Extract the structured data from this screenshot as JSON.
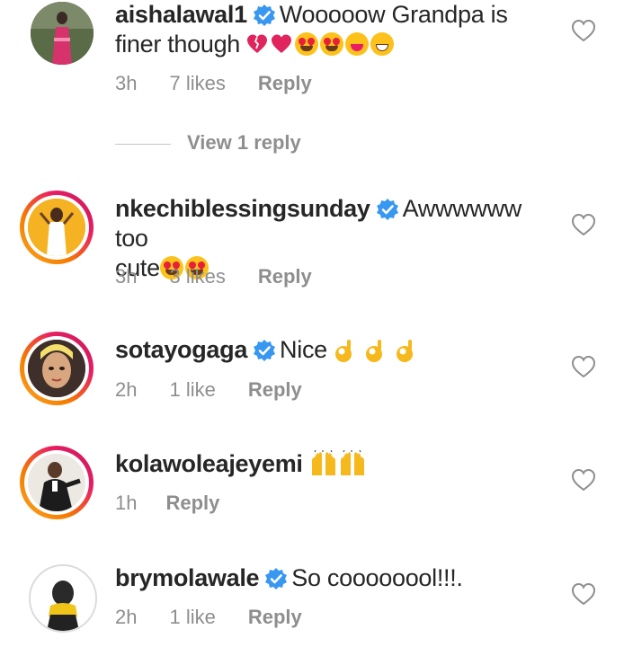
{
  "comments": [
    {
      "username": "aishalawal1",
      "verified": true,
      "text": "Wooooow Grandpa is finer though",
      "time": "3h",
      "likes": "7 likes",
      "reply_label": "Reply",
      "emoji": [
        "broken-heart",
        "red-heart",
        "heart-eyes",
        "heart-eyes",
        "squinting-tongue",
        "grinning"
      ]
    },
    {
      "username": "nkechiblessingsunday",
      "verified": true,
      "text_line1": "Awwwwww too",
      "text_line2": "cute",
      "time": "3h",
      "likes": "3 likes",
      "reply_label": "Reply",
      "emoji": [
        "heart-eyes",
        "heart-eyes"
      ]
    },
    {
      "username": "sotayogaga",
      "verified": true,
      "text": "Nice",
      "time": "2h",
      "likes": "1 like",
      "reply_label": "Reply",
      "emoji": [
        "ok-hand",
        "ok-hand",
        "ok-hand"
      ]
    },
    {
      "username": "kolawoleajeyemi",
      "verified": false,
      "text": "",
      "time": "1h",
      "reply_label": "Reply",
      "emoji": [
        "raising-hands",
        "raising-hands"
      ]
    },
    {
      "username": "brymolawale",
      "verified": true,
      "text": "So coooooool!!!.",
      "time": "2h",
      "likes": "1 like",
      "reply_label": "Reply"
    }
  ],
  "view_replies": "View 1 reply",
  "colors": {
    "verified": "#3897f0",
    "meta": "#8e8e8e",
    "text": "#262626",
    "ring_start": "#f9a825",
    "ring_end": "#c2185b"
  },
  "icons": {
    "like": "heart-outline-icon",
    "verified": "verified-badge-icon"
  }
}
